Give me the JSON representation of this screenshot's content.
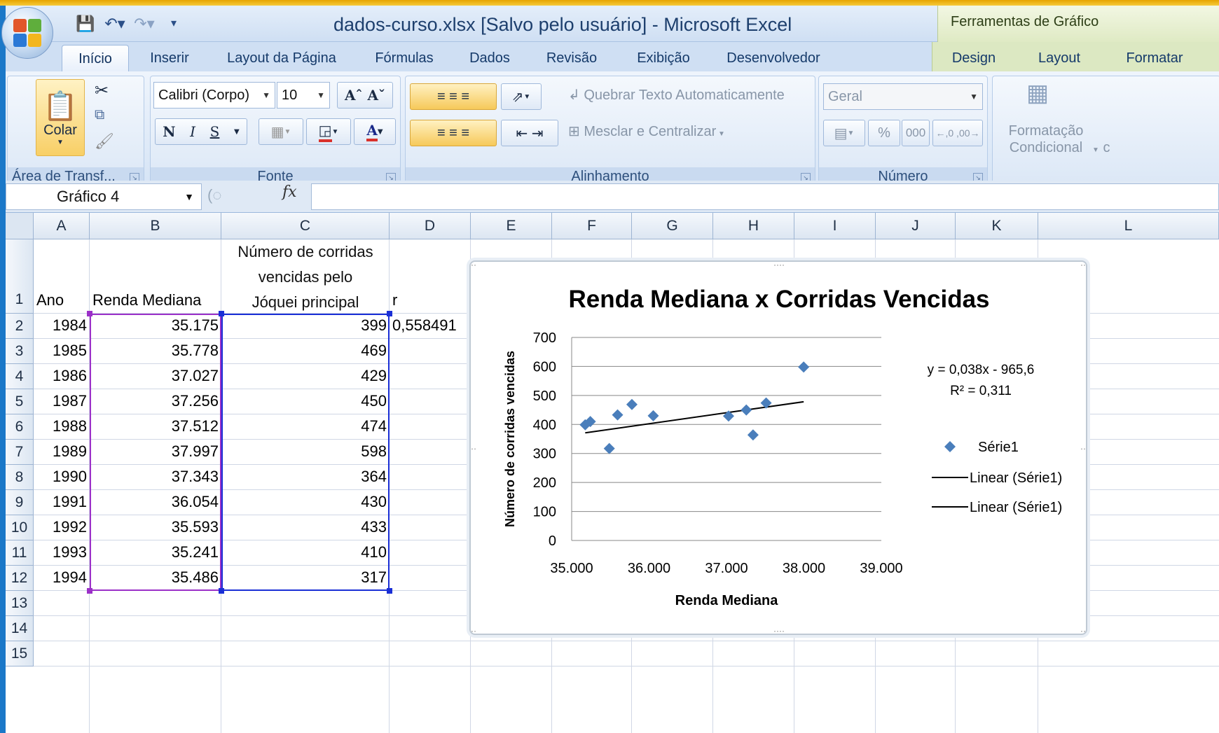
{
  "window": {
    "title": "dados-curso.xlsx [Salvo pelo usuário] - Microsoft Excel",
    "context_title": "Ferramentas de Gráfico"
  },
  "tabs": [
    "Início",
    "Inserir",
    "Layout da Página",
    "Fórmulas",
    "Dados",
    "Revisão",
    "Exibição",
    "Desenvolvedor"
  ],
  "context_tabs": [
    "Design",
    "Layout",
    "Formatar"
  ],
  "active_tab": "Início",
  "ribbon": {
    "clipboard": {
      "paste_label": "Colar",
      "group_label": "Área de Transf..."
    },
    "font": {
      "font_name": "Calibri (Corpo)",
      "font_size": "10",
      "bold": "N",
      "italic": "I",
      "underline": "S",
      "group_label": "Fonte"
    },
    "alignment": {
      "wrap_text": "Quebrar Texto Automaticamente",
      "merge_center": "Mesclar e Centralizar",
      "group_label": "Alinhamento"
    },
    "number": {
      "format": "Geral",
      "percent": "%",
      "thousands": "000",
      "group_label": "Número"
    },
    "styles": {
      "conditional_line1": "Formatação",
      "conditional_line2": "Condicional",
      "cut_letter": "c"
    }
  },
  "formula_bar": {
    "name_box": "Gráfico 4",
    "fx": "fx",
    "content": ""
  },
  "columns": [
    "A",
    "B",
    "C",
    "D",
    "E",
    "F",
    "G",
    "H",
    "I",
    "J",
    "K",
    "L"
  ],
  "rows": [
    "1",
    "2",
    "3",
    "4",
    "5",
    "6",
    "7",
    "8",
    "9",
    "10",
    "11",
    "12",
    "13",
    "14",
    "15"
  ],
  "headers": {
    "a1": "Ano",
    "b1": "Renda Mediana",
    "c1_line1": "Número de corridas",
    "c1_line2": "vencidas pelo",
    "c1_line3": "Jóquei principal",
    "d1": "r"
  },
  "table": [
    {
      "ano": "1984",
      "renda": "35.175",
      "corridas": "399",
      "d": "0,558491"
    },
    {
      "ano": "1985",
      "renda": "35.778",
      "corridas": "469",
      "d": ""
    },
    {
      "ano": "1986",
      "renda": "37.027",
      "corridas": "429",
      "d": ""
    },
    {
      "ano": "1987",
      "renda": "37.256",
      "corridas": "450",
      "d": ""
    },
    {
      "ano": "1988",
      "renda": "37.512",
      "corridas": "474",
      "d": ""
    },
    {
      "ano": "1989",
      "renda": "37.997",
      "corridas": "598",
      "d": ""
    },
    {
      "ano": "1990",
      "renda": "37.343",
      "corridas": "364",
      "d": ""
    },
    {
      "ano": "1991",
      "renda": "36.054",
      "corridas": "430",
      "d": ""
    },
    {
      "ano": "1992",
      "renda": "35.593",
      "corridas": "433",
      "d": ""
    },
    {
      "ano": "1993",
      "renda": "35.241",
      "corridas": "410",
      "d": ""
    },
    {
      "ano": "1994",
      "renda": "35.486",
      "corridas": "317",
      "d": ""
    }
  ],
  "colors": {
    "series_marker": "#4a7ebb",
    "trendline": "#000000",
    "sel_b": "#9b30c8",
    "sel_c": "#1a2fd6"
  },
  "chart_data": {
    "type": "scatter",
    "title": "Renda Mediana x Corridas Vencidas",
    "xlabel": "Renda Mediana",
    "ylabel": "Número de corridas  vencidas",
    "xlim": [
      35000,
      39000
    ],
    "ylim": [
      0,
      700
    ],
    "xticks": [
      "35.000",
      "36.000",
      "37.000",
      "38.000",
      "39.000"
    ],
    "yticks": [
      "0",
      "100",
      "200",
      "300",
      "400",
      "500",
      "600",
      "700"
    ],
    "grid": true,
    "legend_position": "right",
    "legend": [
      "Série1",
      "Linear (Série1)",
      "Linear (Série1)"
    ],
    "equation": "y = 0,038x - 965,6",
    "r_squared": "R² = 0,311",
    "series": [
      {
        "name": "Série1",
        "x": [
          35175,
          35778,
          37027,
          37256,
          37512,
          37997,
          37343,
          36054,
          35593,
          35241,
          35486
        ],
        "y": [
          399,
          469,
          429,
          450,
          474,
          598,
          364,
          430,
          433,
          410,
          317
        ]
      }
    ],
    "trendline": {
      "slope": 0.038,
      "intercept": -965.6
    }
  }
}
